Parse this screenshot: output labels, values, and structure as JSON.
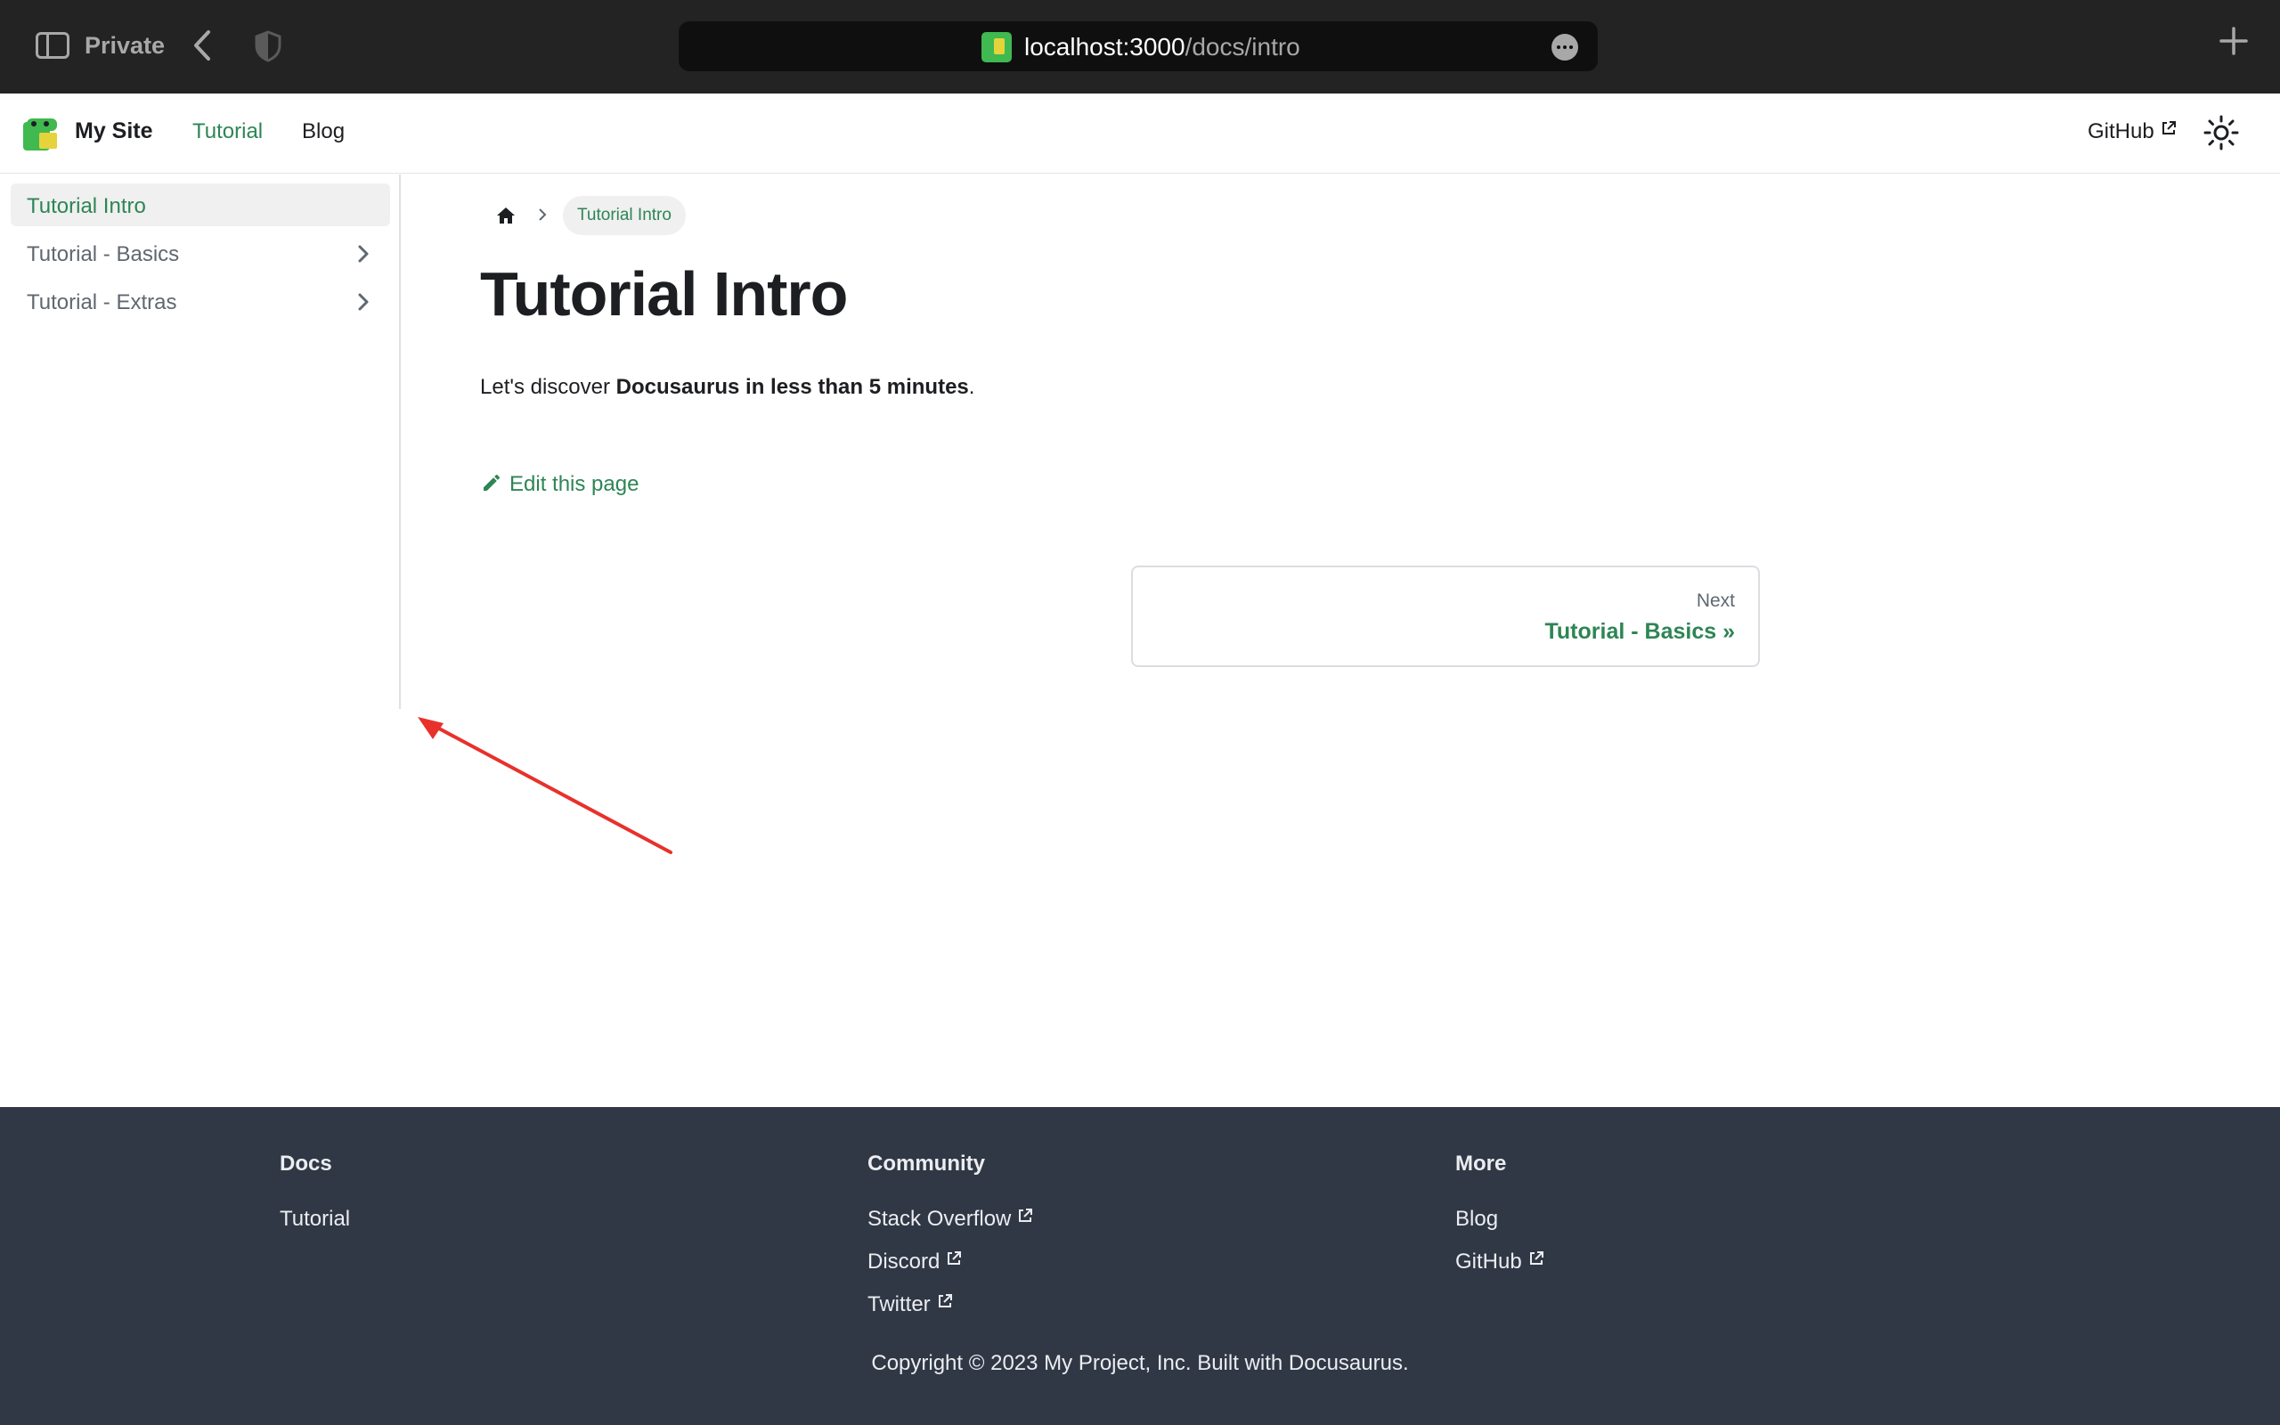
{
  "browser": {
    "mode_label": "Private",
    "url_host": "localhost:3000",
    "url_path": "/docs/intro"
  },
  "navbar": {
    "site_title": "My Site",
    "links": [
      "Tutorial",
      "Blog"
    ],
    "github_label": "GitHub",
    "accent_color": "#2e8555",
    "icons": [
      "logo-icon",
      "external-link-icon",
      "sun-icon"
    ]
  },
  "sidebar": {
    "items": [
      {
        "label": "Tutorial Intro",
        "active": true
      },
      {
        "label": "Tutorial - Basics",
        "active": false
      },
      {
        "label": "Tutorial - Extras",
        "active": false
      }
    ]
  },
  "doc": {
    "breadcrumb": "Tutorial Intro",
    "title": "Tutorial Intro",
    "intro_prefix": "Let's discover ",
    "intro_bold": "Docusaurus in less than 5 minutes",
    "intro_suffix": ".",
    "edit_label": "Edit this page",
    "next_sublabel": "Next",
    "next_label": "Tutorial - Basics »"
  },
  "footer": {
    "columns": [
      {
        "title": "Docs",
        "links": [
          "Tutorial"
        ]
      },
      {
        "title": "Community",
        "links": [
          "Stack Overflow",
          "Discord",
          "Twitter"
        ]
      },
      {
        "title": "More",
        "links": [
          "Blog",
          "GitHub"
        ]
      }
    ],
    "copyright": "Copyright © 2023 My Project, Inc. Built with Docusaurus.",
    "background": "#303846"
  },
  "annotation": {
    "color": "#e8312b"
  }
}
